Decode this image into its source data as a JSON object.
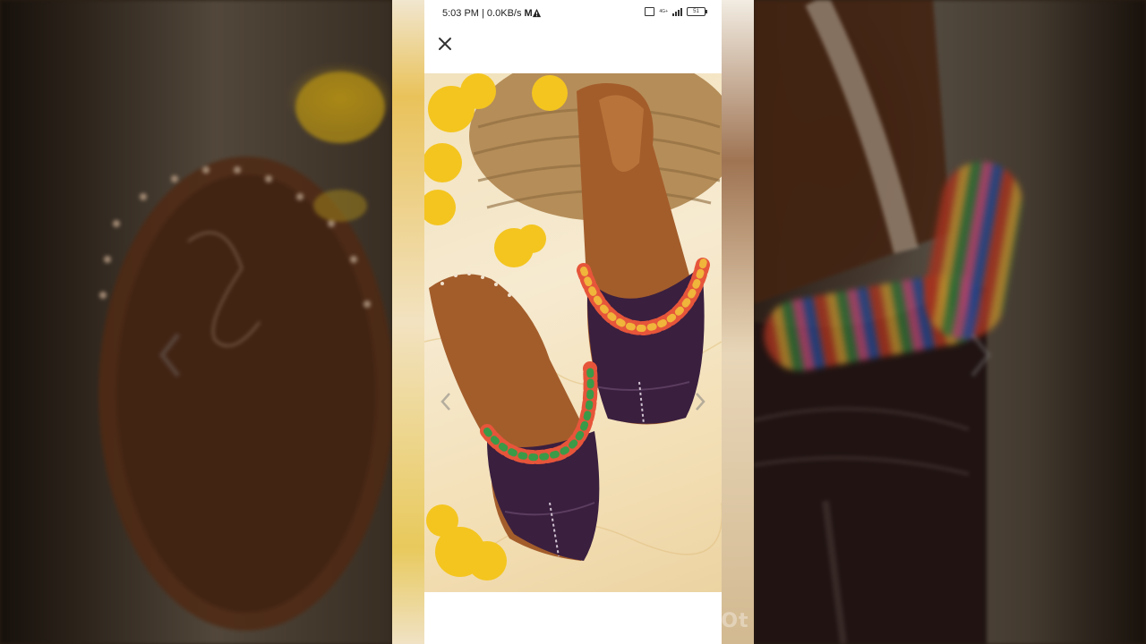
{
  "status_bar": {
    "time_speed": "5:03 PM | 0.0KB/s",
    "carrier_glyph": "M",
    "network": "4G+",
    "battery": "51"
  },
  "viewer": {
    "close_icon": "close-icon",
    "prev_icon": "chevron-left-icon",
    "next_icon": "chevron-right-icon",
    "image_subject": "product photo: purple leather mules with multicolor pom-pom trim, yellow flowers, woven basket"
  },
  "watermark": {
    "text": "InShOt"
  },
  "colors": {
    "shoe_upper": "#3a1f3f",
    "insole": "#a8612f",
    "flowers": "#f2c522",
    "basket": "#b9915d"
  }
}
